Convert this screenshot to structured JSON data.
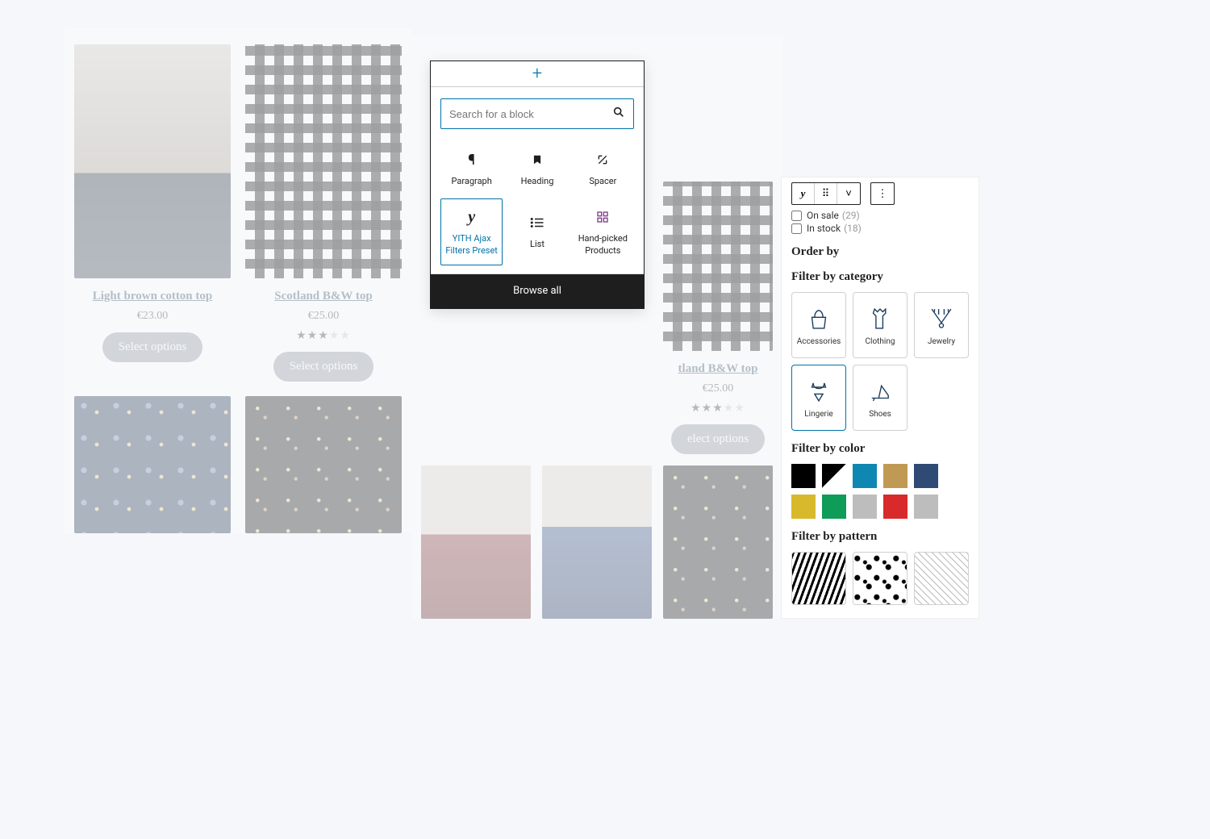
{
  "products_left": {
    "p1": {
      "title": "Light brown cotton top",
      "price": "€23.00",
      "button": "Select options"
    },
    "p2": {
      "title": "Scotland B&W top",
      "price": "€25.00",
      "button": "Select options",
      "rating_text": "★★★"
    }
  },
  "products_mid": {
    "p2": {
      "title": "tland B&W top",
      "price": "€25.00",
      "button": "elect options",
      "rating_text": "★★★"
    }
  },
  "inserter": {
    "search_placeholder": "Search for a block",
    "blocks": {
      "b0": "Paragraph",
      "b1": "Heading",
      "b2": "Spacer",
      "b3": "YITH Ajax Filters Preset",
      "b4": "List",
      "b5": "Hand-picked Products"
    },
    "browse_all": "Browse all"
  },
  "sidebar": {
    "checks": {
      "on_sale": {
        "label": "On sale",
        "count": "(29)"
      },
      "in_stock": {
        "label": "In stock",
        "count": "(18)"
      }
    },
    "order_by": "Order by",
    "filter_category": "Filter by category",
    "categories": {
      "c0": "Accessories",
      "c1": "Clothing",
      "c2": "Jewelry",
      "c3": "Lingerie",
      "c4": "Shoes"
    },
    "filter_color": "Filter by color",
    "colors": {
      "c0": "#000000",
      "c2": "#0e87b3",
      "c3": "#c09a53",
      "c4": "#2e4a75",
      "c5": "#d7b92b",
      "c6": "#0f9b58",
      "c7": "#bdbdbd",
      "c8": "#d82a2a",
      "c9": "#bdbdbd"
    },
    "filter_pattern": "Filter by pattern"
  }
}
